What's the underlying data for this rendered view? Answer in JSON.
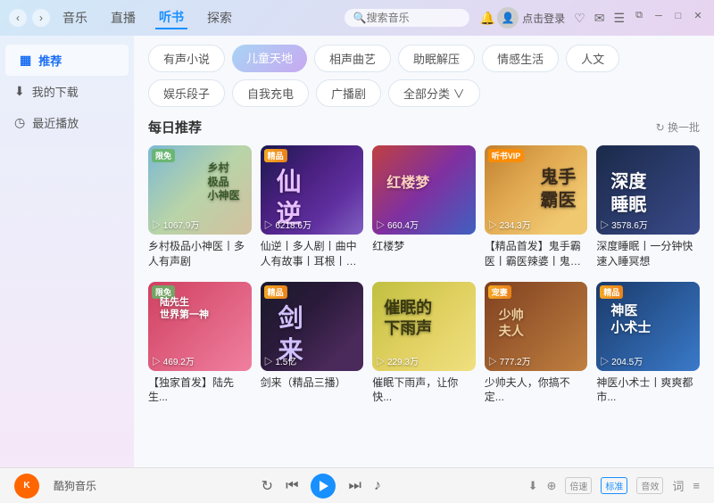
{
  "titlebar": {
    "nav_back": "‹",
    "nav_forward": "›",
    "menu_items": [
      "音乐",
      "直播",
      "听书",
      "探索"
    ],
    "active_menu": "听书",
    "search_placeholder": "搜索音乐",
    "login_text": "点击登录",
    "win_min": "─",
    "win_max": "□",
    "win_close": "✕",
    "win_restore": "⧉",
    "win_icon1": "♡",
    "win_icon2": "✉",
    "win_icon3": "☰",
    "bell_icon": "🔔"
  },
  "sidebar": {
    "items": [
      {
        "id": "recommend",
        "label": "推荐",
        "icon": "▦",
        "active": true
      },
      {
        "id": "download",
        "label": "我的下载",
        "icon": "⬇"
      },
      {
        "id": "recent",
        "label": "最近播放",
        "icon": "◷"
      }
    ]
  },
  "categories": {
    "tabs": [
      {
        "label": "有声小说",
        "active": false
      },
      {
        "label": "儿童天地",
        "active": true
      },
      {
        "label": "相声曲艺",
        "active": false
      },
      {
        "label": "助眠解压",
        "active": false
      },
      {
        "label": "情感生活",
        "active": false
      },
      {
        "label": "人文",
        "active": false
      },
      {
        "label": "娱乐段子",
        "active": false
      },
      {
        "label": "自我充电",
        "active": false
      },
      {
        "label": "广播剧",
        "active": false
      },
      {
        "label": "全部分类 ∨",
        "active": false
      }
    ]
  },
  "daily_section": {
    "title": "每日推荐",
    "refresh_text": "↻ 换一批"
  },
  "cards_row1": [
    {
      "id": "card1",
      "bg": "card-bg-1",
      "badge": "限免",
      "badge_type": "free",
      "play_count": "▷ 1067.9万",
      "inner_text": "乡村\n极品\n小神医",
      "title": "乡村极品小神医丨多人有声剧"
    },
    {
      "id": "card2",
      "bg": "card-bg-2",
      "badge": "精品",
      "badge_type": "premium",
      "play_count": "▷ 6218.6万",
      "inner_text": "仙\n逆",
      "title": "仙逆丨多人剧丨曲中人有故事丨耳根丨大..."
    },
    {
      "id": "card3",
      "bg": "card-bg-3",
      "badge": "",
      "badge_type": "",
      "play_count": "▷ 660.4万",
      "inner_text": "红楼梦",
      "title": "红楼梦"
    },
    {
      "id": "card4",
      "bg": "card-bg-4",
      "badge": "听书VIP",
      "badge_type": "vip",
      "play_count": "▷ 234.3万",
      "inner_text": "鬼手\n霸医",
      "title": "【精品首发】鬼手霸医丨霸医辣婆丨鬼手天..."
    },
    {
      "id": "card5",
      "bg": "card-bg-5",
      "badge": "",
      "badge_type": "",
      "play_count": "▷ 3578.6万",
      "inner_text": "深度\n睡眠",
      "title": "深度睡眠丨一分钟快速入睡冥想"
    }
  ],
  "cards_row2": [
    {
      "id": "card6",
      "bg": "card-bg-6",
      "badge": "限免",
      "badge_type": "free",
      "play_count": "▷ 469.2万",
      "inner_text": "陆先生\n世界第一神",
      "title": "【独家首发】陆先生..."
    },
    {
      "id": "card7",
      "bg": "card-bg-7",
      "badge": "精品",
      "badge_type": "premium",
      "play_count": "▷ 1.5亿",
      "inner_text": "剑\n来",
      "title": "剑来（精品三播）"
    },
    {
      "id": "card8",
      "bg": "card-bg-8",
      "badge": "",
      "badge_type": "",
      "play_count": "▷ 229.3万",
      "inner_text": "催眠的\n下雨声",
      "title": "催眠下雨声，让你快..."
    },
    {
      "id": "card9",
      "bg": "card-bg-9",
      "badge": "宠妻",
      "badge_type": "premium",
      "play_count": "▷ 777.2万",
      "inner_text": "少帅\n夫人",
      "title": "少帅夫人，你搞不定..."
    },
    {
      "id": "card10",
      "bg": "card-bg-10",
      "badge": "精品",
      "badge_type": "premium",
      "play_count": "▷ 204.5万",
      "inner_text": "神医\n小术士",
      "title": "神医小术士丨爽爽都市..."
    }
  ],
  "player": {
    "logo_text": "K",
    "app_name": "酷狗音乐",
    "ctrl_repeat": "↻",
    "ctrl_prev": "⏮",
    "ctrl_play": "▶",
    "ctrl_next": "⏭",
    "ctrl_volume": "♪",
    "right_download": "⬇",
    "right_share": "⊕",
    "right_lyrics": "词",
    "speed_labels": [
      "倍速",
      "标准",
      "音效"
    ],
    "active_speed": "标准",
    "ctrl_list": "≡"
  }
}
